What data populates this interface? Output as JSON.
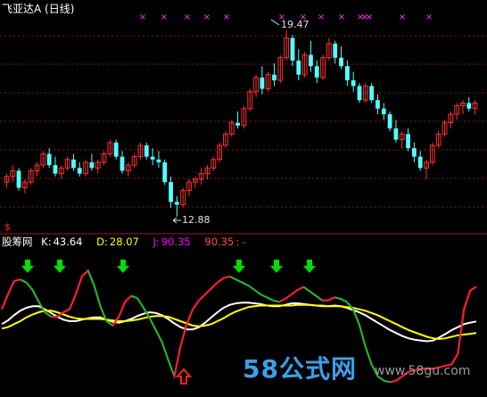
{
  "header": {
    "title": "飞亚达A",
    "period": "(日线)"
  },
  "price_panel": {
    "high_label": "19.47",
    "low_label": "12.88"
  },
  "indicator": {
    "name": "股筹网",
    "k_label": "K:",
    "k_value": "43.64",
    "d_label": "D:",
    "d_value": "28.07",
    "j_label": "J:",
    "j_value": "90.35",
    "extra_value": "90.35",
    "extra_tail": ": -"
  },
  "watermark": {
    "text": "58公式网",
    "url": "www.58gu.com"
  },
  "markers": {
    "bottom_left": "$"
  },
  "colors": {
    "background": "#000000",
    "up": "#ff3030",
    "down": "#54ffff",
    "grid": "#8b1a1a",
    "k": "#ffffff",
    "d": "#ffff00",
    "j": "#ff00ff",
    "signal_arrow": "#00dd00",
    "buy_arrow": "#ff2020",
    "magenta_mark": "#ff33ff"
  },
  "chart_data": [
    {
      "type": "candlestick",
      "title": "",
      "high": 19.47,
      "low": 12.88,
      "ylim": [
        12.4,
        20.1
      ],
      "candles": [
        [
          14.1,
          14.4,
          13.9,
          14.3
        ],
        [
          14.3,
          14.7,
          14.1,
          14.5
        ],
        [
          14.5,
          14.6,
          13.8,
          13.9
        ],
        [
          13.9,
          14.2,
          13.7,
          14.1
        ],
        [
          14.1,
          14.6,
          14.0,
          14.5
        ],
        [
          14.5,
          14.8,
          14.3,
          14.7
        ],
        [
          14.7,
          15.2,
          14.6,
          15.1
        ],
        [
          15.1,
          15.3,
          14.6,
          14.7
        ],
        [
          14.7,
          15.0,
          14.3,
          14.4
        ],
        [
          14.4,
          14.7,
          14.2,
          14.6
        ],
        [
          14.6,
          15.0,
          14.5,
          14.9
        ],
        [
          14.9,
          15.1,
          14.5,
          14.6
        ],
        [
          14.6,
          14.8,
          14.3,
          14.4
        ],
        [
          14.4,
          14.9,
          14.3,
          14.8
        ],
        [
          14.8,
          15.1,
          14.5,
          14.6
        ],
        [
          14.6,
          14.9,
          14.4,
          14.8
        ],
        [
          14.8,
          15.2,
          14.7,
          15.1
        ],
        [
          15.1,
          15.6,
          15.0,
          15.5
        ],
        [
          15.5,
          15.6,
          14.9,
          15.0
        ],
        [
          15.0,
          15.2,
          14.4,
          14.5
        ],
        [
          14.5,
          14.8,
          14.3,
          14.7
        ],
        [
          14.7,
          15.1,
          14.6,
          15.0
        ],
        [
          15.0,
          15.5,
          14.9,
          15.4
        ],
        [
          15.4,
          15.5,
          14.9,
          15.0
        ],
        [
          15.0,
          15.3,
          14.7,
          14.9
        ],
        [
          14.9,
          15.2,
          14.6,
          14.8
        ],
        [
          14.8,
          14.9,
          14.0,
          14.1
        ],
        [
          14.1,
          14.3,
          13.2,
          13.4
        ],
        [
          13.4,
          13.6,
          12.88,
          13.3
        ],
        [
          13.3,
          13.9,
          13.2,
          13.8
        ],
        [
          13.8,
          14.2,
          13.6,
          14.1
        ],
        [
          14.1,
          14.3,
          13.9,
          14.2
        ],
        [
          14.2,
          14.6,
          14.0,
          14.4
        ],
        [
          14.4,
          14.7,
          14.2,
          14.6
        ],
        [
          14.6,
          15.0,
          14.5,
          14.9
        ],
        [
          14.9,
          15.5,
          14.8,
          15.4
        ],
        [
          15.4,
          15.9,
          15.3,
          15.8
        ],
        [
          15.8,
          16.3,
          15.7,
          16.2
        ],
        [
          16.2,
          16.6,
          16.0,
          16.1
        ],
        [
          16.1,
          16.8,
          16.0,
          16.7
        ],
        [
          16.7,
          17.4,
          16.6,
          17.3
        ],
        [
          17.3,
          17.9,
          17.1,
          17.8
        ],
        [
          17.8,
          18.2,
          17.2,
          17.4
        ],
        [
          17.4,
          18.0,
          17.3,
          17.9
        ],
        [
          17.9,
          18.3,
          17.5,
          17.7
        ],
        [
          17.7,
          18.6,
          17.6,
          18.5
        ],
        [
          18.5,
          19.47,
          18.4,
          19.2
        ],
        [
          19.2,
          19.3,
          18.2,
          18.4
        ],
        [
          18.4,
          18.8,
          17.7,
          17.9
        ],
        [
          17.9,
          18.7,
          17.8,
          18.6
        ],
        [
          18.6,
          19.1,
          18.0,
          18.2
        ],
        [
          18.2,
          18.4,
          17.6,
          17.8
        ],
        [
          17.8,
          18.6,
          17.7,
          18.5
        ],
        [
          18.5,
          19.2,
          18.4,
          19.0
        ],
        [
          19.0,
          19.1,
          18.3,
          18.5
        ],
        [
          18.5,
          18.9,
          18.1,
          18.2
        ],
        [
          18.2,
          18.4,
          17.5,
          17.7
        ],
        [
          17.7,
          18.0,
          17.3,
          17.5
        ],
        [
          17.5,
          17.6,
          16.9,
          17.0
        ],
        [
          17.0,
          17.6,
          16.9,
          17.5
        ],
        [
          17.5,
          17.6,
          16.9,
          17.0
        ],
        [
          17.0,
          17.2,
          16.5,
          16.7
        ],
        [
          16.7,
          16.9,
          16.3,
          16.5
        ],
        [
          16.5,
          16.6,
          15.9,
          16.0
        ],
        [
          16.0,
          16.3,
          15.5,
          15.6
        ],
        [
          15.6,
          15.9,
          15.3,
          15.8
        ],
        [
          15.8,
          16.0,
          15.2,
          15.3
        ],
        [
          15.3,
          15.5,
          14.8,
          15.0
        ],
        [
          15.0,
          15.2,
          14.5,
          14.6
        ],
        [
          14.6,
          14.9,
          14.2,
          14.8
        ],
        [
          14.8,
          15.5,
          14.7,
          15.4
        ],
        [
          15.4,
          15.9,
          15.3,
          15.8
        ],
        [
          15.8,
          16.3,
          15.7,
          16.2
        ],
        [
          16.2,
          16.6,
          16.0,
          16.5
        ],
        [
          16.5,
          16.9,
          16.3,
          16.8
        ],
        [
          16.8,
          17.0,
          16.5,
          16.9
        ],
        [
          16.9,
          17.1,
          16.6,
          16.7
        ],
        [
          16.7,
          17.0,
          16.5,
          16.9
        ]
      ]
    },
    {
      "type": "line",
      "title": "股筹网",
      "ylim": [
        -40,
        140
      ],
      "series": [
        {
          "name": "K",
          "values": [
            40,
            45,
            52,
            58,
            62,
            64,
            64,
            60,
            55,
            50,
            46,
            44,
            44,
            46,
            48,
            49,
            49,
            46,
            43,
            42,
            44,
            47,
            51,
            54,
            56,
            55,
            52,
            47,
            41,
            36,
            33,
            33,
            36,
            42,
            49,
            56,
            62,
            66,
            68,
            69,
            69,
            68,
            67,
            65,
            64,
            64,
            66,
            68,
            68,
            67,
            66,
            65,
            64,
            64,
            65,
            64,
            62,
            59,
            56,
            52,
            47,
            42,
            37,
            32,
            28,
            24,
            21,
            19,
            18,
            17,
            18,
            22,
            27,
            32,
            36,
            40,
            42,
            43.64
          ]
        },
        {
          "name": "D",
          "values": [
            34,
            36,
            40,
            44,
            49,
            53,
            56,
            58,
            58,
            56,
            53,
            50,
            48,
            47,
            47,
            47,
            47,
            46,
            45,
            44,
            44,
            45,
            46,
            48,
            50,
            51,
            51,
            50,
            47,
            44,
            41,
            38,
            37,
            38,
            40,
            44,
            48,
            53,
            57,
            60,
            63,
            64,
            65,
            65,
            65,
            65,
            65,
            65,
            66,
            66,
            66,
            65,
            65,
            64,
            64,
            64,
            63,
            62,
            60,
            58,
            55,
            52,
            48,
            44,
            40,
            36,
            32,
            29,
            26,
            23,
            21,
            20,
            21,
            23,
            25,
            26,
            27,
            28.07
          ]
        },
        {
          "name": "J",
          "values": [
            60,
            80,
            98,
            100,
            96,
            86,
            70,
            56,
            50,
            50,
            56,
            60,
            80,
            104,
            112,
            92,
            64,
            44,
            38,
            50,
            70,
            78,
            75,
            62,
            48,
            32,
            16,
            -8,
            -30,
            10,
            40,
            60,
            72,
            80,
            88,
            96,
            102,
            104,
            100,
            96,
            92,
            86,
            80,
            76,
            72,
            70,
            74,
            80,
            86,
            90,
            84,
            78,
            72,
            72,
            76,
            74,
            70,
            60,
            40,
            10,
            -14,
            -30,
            -36,
            -38,
            -36,
            -30,
            -24,
            -22,
            -20,
            -20,
            -20,
            -18,
            -16,
            -14,
            0,
            60,
            85,
            90.35
          ]
        }
      ]
    }
  ]
}
